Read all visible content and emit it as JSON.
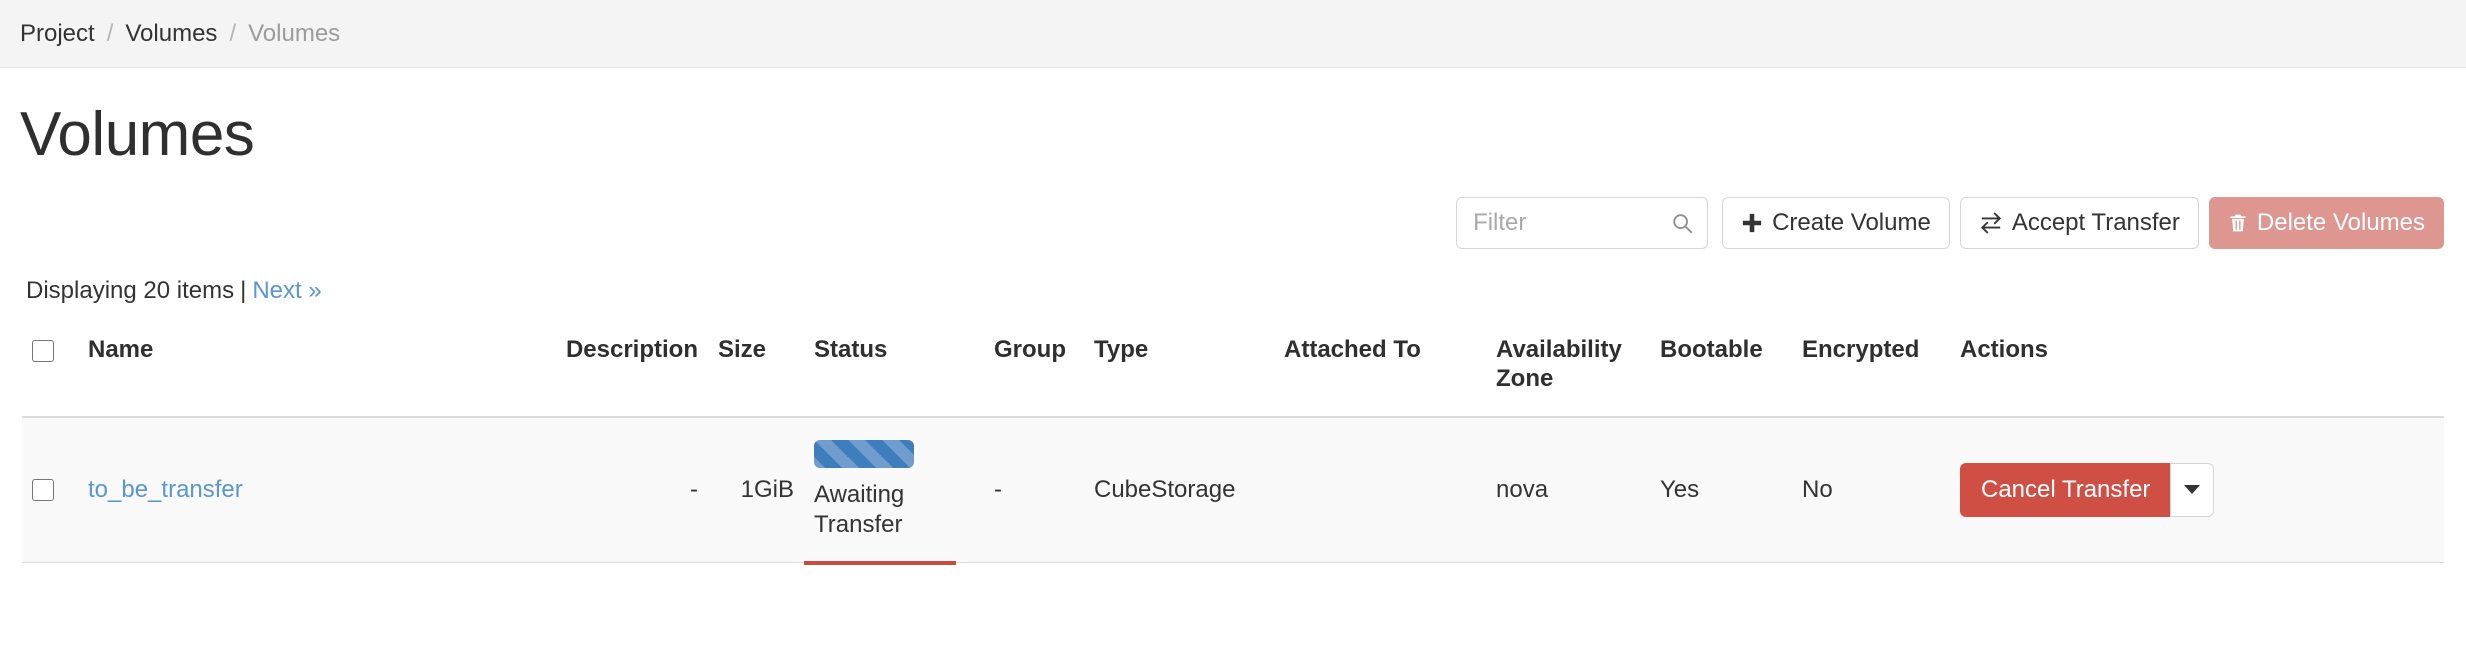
{
  "breadcrumb": {
    "items": [
      {
        "label": "Project",
        "active": false
      },
      {
        "label": "Volumes",
        "active": false
      },
      {
        "label": "Volumes",
        "active": true
      }
    ],
    "separator": "/"
  },
  "page": {
    "title": "Volumes"
  },
  "toolbar": {
    "filter_placeholder": "Filter",
    "filter_value": "",
    "search_icon": "search-icon",
    "create_volume_label": "Create Volume",
    "create_volume_icon": "plus-icon",
    "accept_transfer_label": "Accept Transfer",
    "accept_transfer_icon": "exchange-icon",
    "delete_volumes_label": "Delete Volumes",
    "delete_volumes_icon": "trash-icon",
    "delete_color": "#dd9690"
  },
  "summary": {
    "text": "Displaying 20 items",
    "separator": "|",
    "next_label": "Next »",
    "link_color": "#5b96d2"
  },
  "table": {
    "columns": [
      {
        "key": "check",
        "label": ""
      },
      {
        "key": "name",
        "label": "Name"
      },
      {
        "key": "description",
        "label": "Description"
      },
      {
        "key": "size",
        "label": "Size"
      },
      {
        "key": "status",
        "label": "Status"
      },
      {
        "key": "group",
        "label": "Group"
      },
      {
        "key": "type",
        "label": "Type"
      },
      {
        "key": "attached_to",
        "label": "Attached To"
      },
      {
        "key": "availability_zone",
        "label": "Availability Zone"
      },
      {
        "key": "bootable",
        "label": "Bootable"
      },
      {
        "key": "encrypted",
        "label": "Encrypted"
      },
      {
        "key": "actions",
        "label": "Actions"
      }
    ],
    "rows": [
      {
        "name": "to_be_transfer",
        "description": "-",
        "size": "1GiB",
        "status": "Awaiting Transfer",
        "status_progress_percent": 100,
        "status_progress_color": "#3f7ebd",
        "group": "-",
        "type": "CubeStorage",
        "attached_to": "",
        "availability_zone": "nova",
        "bootable": "Yes",
        "encrypted": "No",
        "action_label": "Cancel Transfer",
        "action_color": "#cf4f45",
        "action_caret_icon": "chevron-down-icon"
      }
    ]
  }
}
